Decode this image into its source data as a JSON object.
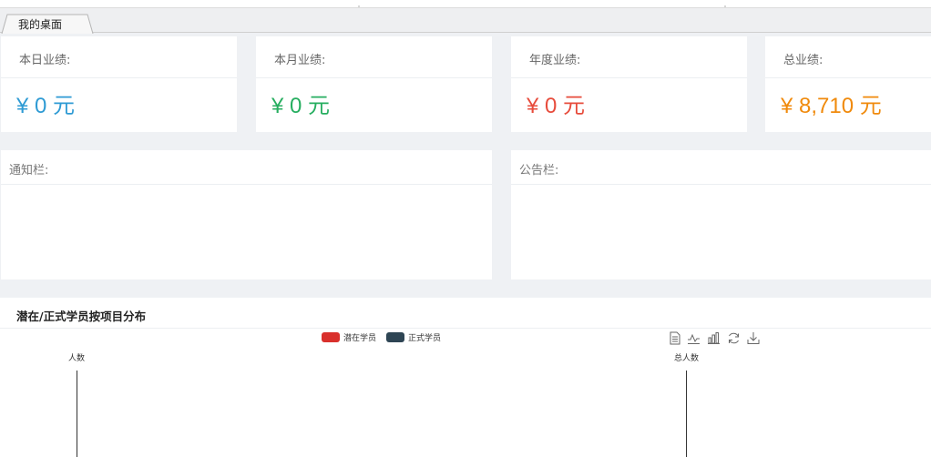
{
  "tab": {
    "label": "我的桌面"
  },
  "stats": [
    {
      "label": "本日业绩:",
      "value": "¥ 0 元",
      "color": "#2f9bd4"
    },
    {
      "label": "本月业绩:",
      "value": "¥ 0 元",
      "color": "#27ae60"
    },
    {
      "label": "年度业绩:",
      "value": "¥ 0 元",
      "color": "#e74c3c"
    },
    {
      "label": "总业绩:",
      "value": "¥ 8,710 元",
      "color": "#f08a0c"
    }
  ],
  "panels": {
    "notice": {
      "title": "通知栏:"
    },
    "announcement": {
      "title": "公告栏:"
    }
  },
  "chart_panel": {
    "title": "潜在/正式学员按项目分布",
    "legend": [
      {
        "name": "潜在学员",
        "color": "#d9302c"
      },
      {
        "name": "正式学员",
        "color": "#2e4554"
      }
    ],
    "toolbox": [
      "data-view-icon",
      "line-chart-icon",
      "bar-chart-icon",
      "restore-icon",
      "save-image-icon"
    ]
  },
  "chart_data": {
    "type": "bar",
    "title": "潜在/正式学员按项目分布",
    "series": [
      {
        "name": "潜在学员",
        "values": []
      },
      {
        "name": "正式学员",
        "values": []
      }
    ],
    "ylabel": "人数",
    "y2label": "总人数",
    "categories": []
  }
}
